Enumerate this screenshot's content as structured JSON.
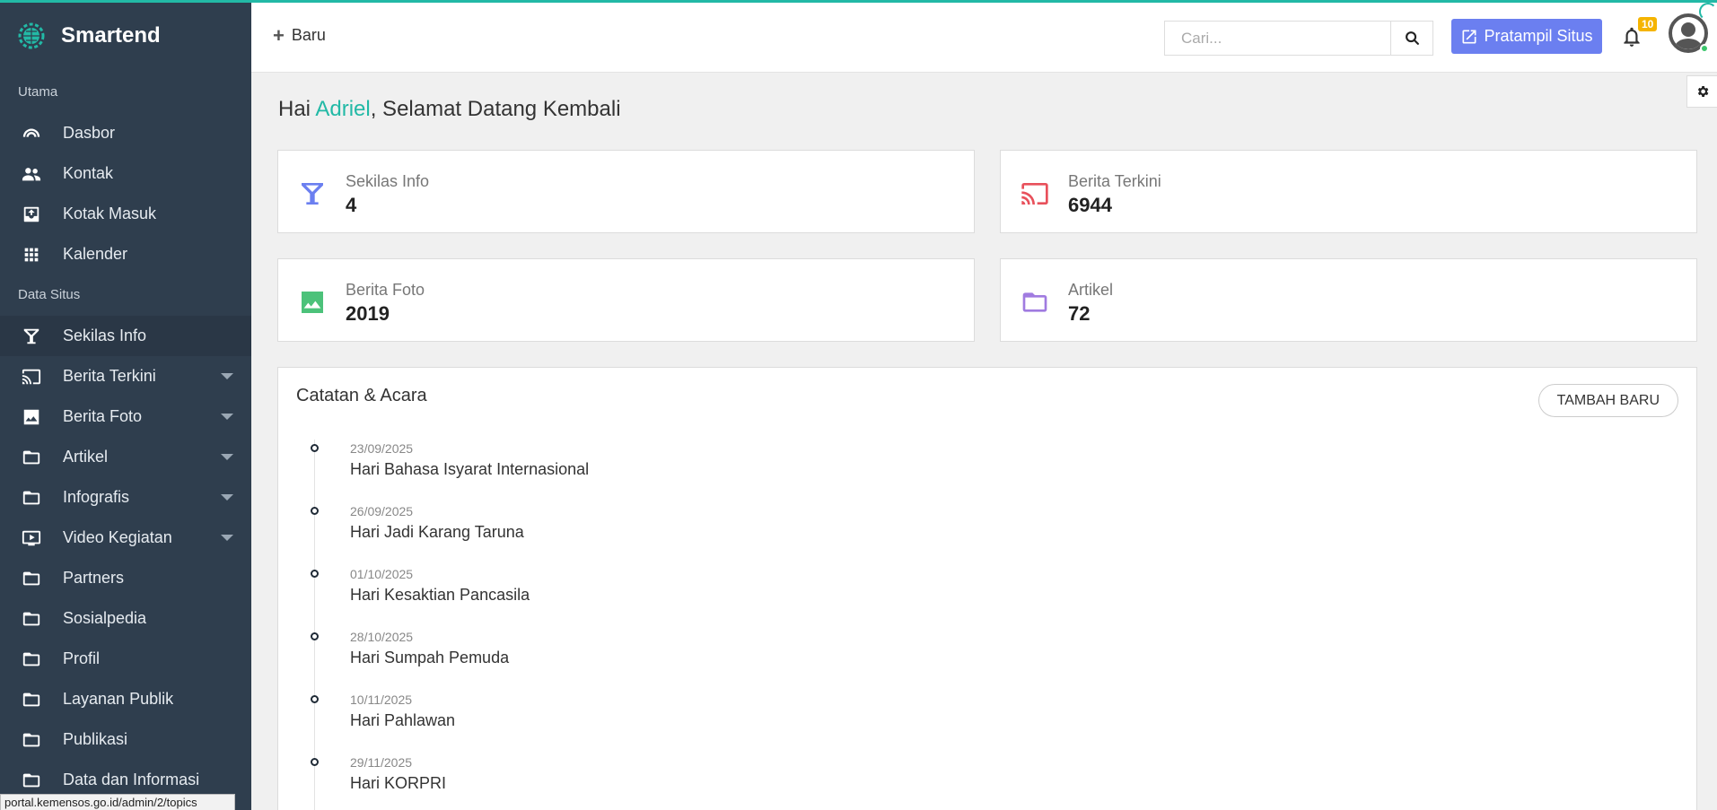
{
  "brand": {
    "name": "Smartend"
  },
  "sidebar": {
    "sections": [
      {
        "label": "Utama",
        "items": [
          {
            "label": "Dasbor",
            "icon": "dashboard-icon"
          },
          {
            "label": "Kontak",
            "icon": "people-icon"
          },
          {
            "label": "Kotak Masuk",
            "icon": "inbox-icon"
          },
          {
            "label": "Kalender",
            "icon": "grid-icon"
          }
        ]
      },
      {
        "label": "Data Situs",
        "items": [
          {
            "label": "Sekilas Info",
            "icon": "filter-icon",
            "active": true
          },
          {
            "label": "Berita Terkini",
            "icon": "cast-icon",
            "expandable": true
          },
          {
            "label": "Berita Foto",
            "icon": "image-icon",
            "expandable": true
          },
          {
            "label": "Artikel",
            "icon": "folder-icon",
            "expandable": true
          },
          {
            "label": "Infografis",
            "icon": "folder-icon",
            "expandable": true
          },
          {
            "label": "Video Kegiatan",
            "icon": "video-icon",
            "expandable": true
          },
          {
            "label": "Partners",
            "icon": "folder-icon"
          },
          {
            "label": "Sosialpedia",
            "icon": "folder-icon"
          },
          {
            "label": "Profil",
            "icon": "folder-icon"
          },
          {
            "label": "Layanan Publik",
            "icon": "folder-icon"
          },
          {
            "label": "Publikasi",
            "icon": "folder-icon"
          },
          {
            "label": "Data dan Informasi",
            "icon": "folder-icon"
          }
        ]
      }
    ]
  },
  "statusbar": {
    "url": "portal.kemensos.go.id/admin/2/topics"
  },
  "header": {
    "new_label": "Baru",
    "search_placeholder": "Cari...",
    "preview_label": "Pratampil Situs",
    "notification_count": "10"
  },
  "greeting": {
    "prefix": "Hai ",
    "name": "Adriel",
    "suffix": ", Selamat Datang Kembali"
  },
  "stats": [
    {
      "title": "Sekilas Info",
      "value": "4",
      "icon": "filter-icon",
      "color": "#6b7ff0"
    },
    {
      "title": "Berita Terkini",
      "value": "6944",
      "icon": "cast-icon",
      "color": "#e8505b"
    },
    {
      "title": "Berita Foto",
      "value": "2019",
      "icon": "image-icon",
      "color": "#4cc27a"
    },
    {
      "title": "Artikel",
      "value": "72",
      "icon": "folder-icon",
      "color": "#a07be0"
    }
  ],
  "events_panel": {
    "title": "Catatan & Acara",
    "add_label": "TAMBAH BARU",
    "events": [
      {
        "date": "23/09/2025",
        "name": "Hari Bahasa Isyarat Internasional"
      },
      {
        "date": "26/09/2025",
        "name": "Hari Jadi Karang Taruna"
      },
      {
        "date": "01/10/2025",
        "name": "Hari Kesaktian Pancasila"
      },
      {
        "date": "28/10/2025",
        "name": "Hari Sumpah Pemuda"
      },
      {
        "date": "10/11/2025",
        "name": "Hari Pahlawan"
      },
      {
        "date": "29/11/2025",
        "name": "Hari KORPRI"
      }
    ]
  },
  "colors": {
    "accent": "#22b9a6",
    "sidebar_bg": "#2f3e4e",
    "preview_btn": "#6b7ff0",
    "badge": "#f5b400"
  }
}
